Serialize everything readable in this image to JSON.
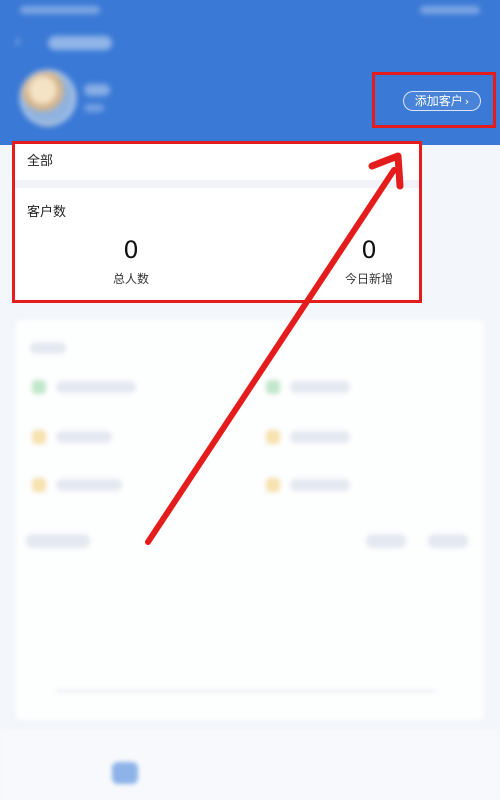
{
  "header": {
    "add_customer_label": "添加客户"
  },
  "summary_card": {
    "tab_label": "全部",
    "section_title": "客户数",
    "stats": [
      {
        "value": "0",
        "label": "总人数"
      },
      {
        "value": "0",
        "label": "今日新增"
      }
    ]
  },
  "colors": {
    "header_bg": "#3a79d6",
    "highlight": "#e51c1c"
  },
  "icons": {
    "back": "back-arrow-icon",
    "chevron": "chevron-right-icon"
  }
}
